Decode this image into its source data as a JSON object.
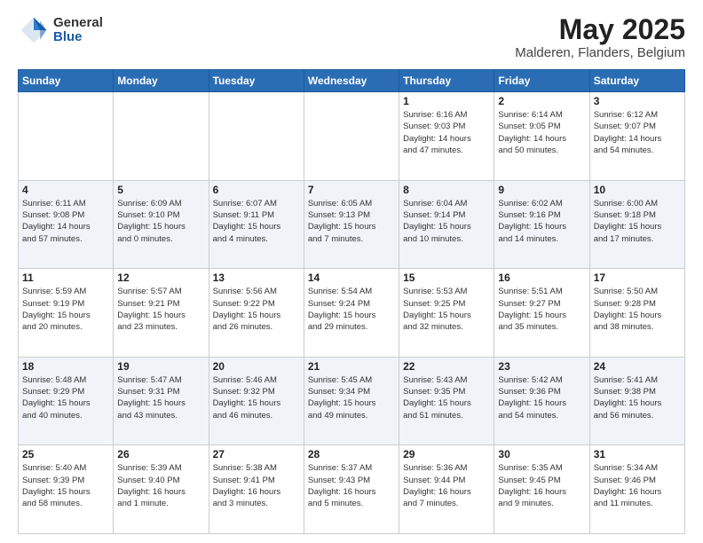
{
  "logo": {
    "general": "General",
    "blue": "Blue"
  },
  "header": {
    "month": "May 2025",
    "location": "Malderen, Flanders, Belgium"
  },
  "weekdays": [
    "Sunday",
    "Monday",
    "Tuesday",
    "Wednesday",
    "Thursday",
    "Friday",
    "Saturday"
  ],
  "weeks": [
    [
      {
        "day": "",
        "info": ""
      },
      {
        "day": "",
        "info": ""
      },
      {
        "day": "",
        "info": ""
      },
      {
        "day": "",
        "info": ""
      },
      {
        "day": "1",
        "info": "Sunrise: 6:16 AM\nSunset: 9:03 PM\nDaylight: 14 hours\nand 47 minutes."
      },
      {
        "day": "2",
        "info": "Sunrise: 6:14 AM\nSunset: 9:05 PM\nDaylight: 14 hours\nand 50 minutes."
      },
      {
        "day": "3",
        "info": "Sunrise: 6:12 AM\nSunset: 9:07 PM\nDaylight: 14 hours\nand 54 minutes."
      }
    ],
    [
      {
        "day": "4",
        "info": "Sunrise: 6:11 AM\nSunset: 9:08 PM\nDaylight: 14 hours\nand 57 minutes."
      },
      {
        "day": "5",
        "info": "Sunrise: 6:09 AM\nSunset: 9:10 PM\nDaylight: 15 hours\nand 0 minutes."
      },
      {
        "day": "6",
        "info": "Sunrise: 6:07 AM\nSunset: 9:11 PM\nDaylight: 15 hours\nand 4 minutes."
      },
      {
        "day": "7",
        "info": "Sunrise: 6:05 AM\nSunset: 9:13 PM\nDaylight: 15 hours\nand 7 minutes."
      },
      {
        "day": "8",
        "info": "Sunrise: 6:04 AM\nSunset: 9:14 PM\nDaylight: 15 hours\nand 10 minutes."
      },
      {
        "day": "9",
        "info": "Sunrise: 6:02 AM\nSunset: 9:16 PM\nDaylight: 15 hours\nand 14 minutes."
      },
      {
        "day": "10",
        "info": "Sunrise: 6:00 AM\nSunset: 9:18 PM\nDaylight: 15 hours\nand 17 minutes."
      }
    ],
    [
      {
        "day": "11",
        "info": "Sunrise: 5:59 AM\nSunset: 9:19 PM\nDaylight: 15 hours\nand 20 minutes."
      },
      {
        "day": "12",
        "info": "Sunrise: 5:57 AM\nSunset: 9:21 PM\nDaylight: 15 hours\nand 23 minutes."
      },
      {
        "day": "13",
        "info": "Sunrise: 5:56 AM\nSunset: 9:22 PM\nDaylight: 15 hours\nand 26 minutes."
      },
      {
        "day": "14",
        "info": "Sunrise: 5:54 AM\nSunset: 9:24 PM\nDaylight: 15 hours\nand 29 minutes."
      },
      {
        "day": "15",
        "info": "Sunrise: 5:53 AM\nSunset: 9:25 PM\nDaylight: 15 hours\nand 32 minutes."
      },
      {
        "day": "16",
        "info": "Sunrise: 5:51 AM\nSunset: 9:27 PM\nDaylight: 15 hours\nand 35 minutes."
      },
      {
        "day": "17",
        "info": "Sunrise: 5:50 AM\nSunset: 9:28 PM\nDaylight: 15 hours\nand 38 minutes."
      }
    ],
    [
      {
        "day": "18",
        "info": "Sunrise: 5:48 AM\nSunset: 9:29 PM\nDaylight: 15 hours\nand 40 minutes."
      },
      {
        "day": "19",
        "info": "Sunrise: 5:47 AM\nSunset: 9:31 PM\nDaylight: 15 hours\nand 43 minutes."
      },
      {
        "day": "20",
        "info": "Sunrise: 5:46 AM\nSunset: 9:32 PM\nDaylight: 15 hours\nand 46 minutes."
      },
      {
        "day": "21",
        "info": "Sunrise: 5:45 AM\nSunset: 9:34 PM\nDaylight: 15 hours\nand 49 minutes."
      },
      {
        "day": "22",
        "info": "Sunrise: 5:43 AM\nSunset: 9:35 PM\nDaylight: 15 hours\nand 51 minutes."
      },
      {
        "day": "23",
        "info": "Sunrise: 5:42 AM\nSunset: 9:36 PM\nDaylight: 15 hours\nand 54 minutes."
      },
      {
        "day": "24",
        "info": "Sunrise: 5:41 AM\nSunset: 9:38 PM\nDaylight: 15 hours\nand 56 minutes."
      }
    ],
    [
      {
        "day": "25",
        "info": "Sunrise: 5:40 AM\nSunset: 9:39 PM\nDaylight: 15 hours\nand 58 minutes."
      },
      {
        "day": "26",
        "info": "Sunrise: 5:39 AM\nSunset: 9:40 PM\nDaylight: 16 hours\nand 1 minute."
      },
      {
        "day": "27",
        "info": "Sunrise: 5:38 AM\nSunset: 9:41 PM\nDaylight: 16 hours\nand 3 minutes."
      },
      {
        "day": "28",
        "info": "Sunrise: 5:37 AM\nSunset: 9:43 PM\nDaylight: 16 hours\nand 5 minutes."
      },
      {
        "day": "29",
        "info": "Sunrise: 5:36 AM\nSunset: 9:44 PM\nDaylight: 16 hours\nand 7 minutes."
      },
      {
        "day": "30",
        "info": "Sunrise: 5:35 AM\nSunset: 9:45 PM\nDaylight: 16 hours\nand 9 minutes."
      },
      {
        "day": "31",
        "info": "Sunrise: 5:34 AM\nSunset: 9:46 PM\nDaylight: 16 hours\nand 11 minutes."
      }
    ]
  ]
}
